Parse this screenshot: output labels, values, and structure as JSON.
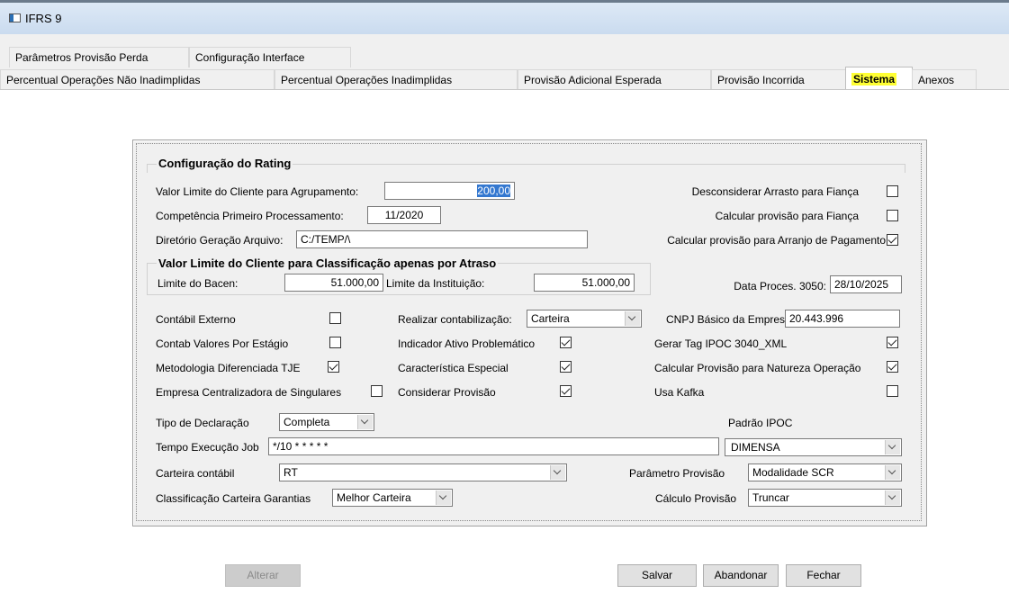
{
  "window": {
    "title": "IFRS 9"
  },
  "tabs_row1": [
    "Parâmetros Provisão Perda",
    "Configuração Interface"
  ],
  "tabs_row2": [
    "Percentual Operações Não Inadimplidas",
    "Percentual Operações Inadimplidas",
    "Provisão Adicional Esperada",
    "Provisão Incorrida",
    "Sistema",
    "Anexos"
  ],
  "rating": {
    "title": "Configuração do Rating",
    "valor_limite_label": "Valor Limite do Cliente para Agrupamento:",
    "valor_limite_value": "200,00",
    "competencia_label": "Competência Primeiro Processamento:",
    "competencia_value": "11/2020",
    "diretorio_label": "Diretório Geração Arquivo:",
    "diretorio_value": "C:/TEMP/\\",
    "desconsiderar_label": "Desconsiderar Arrasto para Fiança",
    "desconsiderar_checked": false,
    "calc_fianca_label": "Calcular provisão para Fiança",
    "calc_fianca_checked": false,
    "calc_arranjo_label": "Calcular provisão para Arranjo de Pagamento",
    "calc_arranjo_checked": true
  },
  "atraso": {
    "title": "Valor Limite do Cliente para Classificação apenas por Atraso",
    "bacen_label": "Limite do Bacen:",
    "bacen_value": "51.000,00",
    "instituicao_label": "Limite da Instituição:",
    "instituicao_value": "51.000,00",
    "data_proces_label": "Data Proces. 3050:",
    "data_proces_value": "28/10/2025"
  },
  "options": {
    "contabil_externo": "Contábil Externo",
    "contab_valores": "Contab Valores Por Estágio",
    "metodologia": "Metodologia Diferenciada TJE",
    "empresa_centralizadora": "Empresa Centralizadora de Singulares",
    "realizar_contab_label": "Realizar contabilização:",
    "realizar_contab_value": "Carteira",
    "indicador_ativo": "Indicador Ativo Problemático",
    "caracteristica": "Característica Especial",
    "considerar_provisao": "Considerar Provisão",
    "cnpj_label": "CNPJ Básico da Empresa:",
    "cnpj_value": "20.443.996",
    "gerar_tag": "Gerar Tag IPOC 3040_XML",
    "calc_natureza": "Calcular Provisão para Natureza Operação",
    "usa_kafka": "Usa Kafka"
  },
  "config": {
    "tipo_decl_label": "Tipo de Declaração",
    "tipo_decl_value": "Completa",
    "padrao_ipoc_label": "Padrão IPOC",
    "padrao_ipoc_value": "DIMENSA",
    "tempo_job_label": "Tempo Execução Job",
    "tempo_job_value": "*/10 * * * * *",
    "carteira_label": "Carteira contábil",
    "carteira_value": "RT",
    "param_prov_label": "Parâmetro Provisão",
    "param_prov_value": "Modalidade SCR",
    "class_garantias_label": "Classificação Carteira Garantias",
    "class_garantias_value": "Melhor Carteira",
    "calc_prov_label": "Cálculo Provisão",
    "calc_prov_value": "Truncar"
  },
  "buttons": {
    "alterar": "Alterar",
    "salvar": "Salvar",
    "abandonar": "Abandonar",
    "fechar": "Fechar"
  },
  "colors": {
    "highlight": "#ffff33",
    "selection": "#3478d0"
  }
}
